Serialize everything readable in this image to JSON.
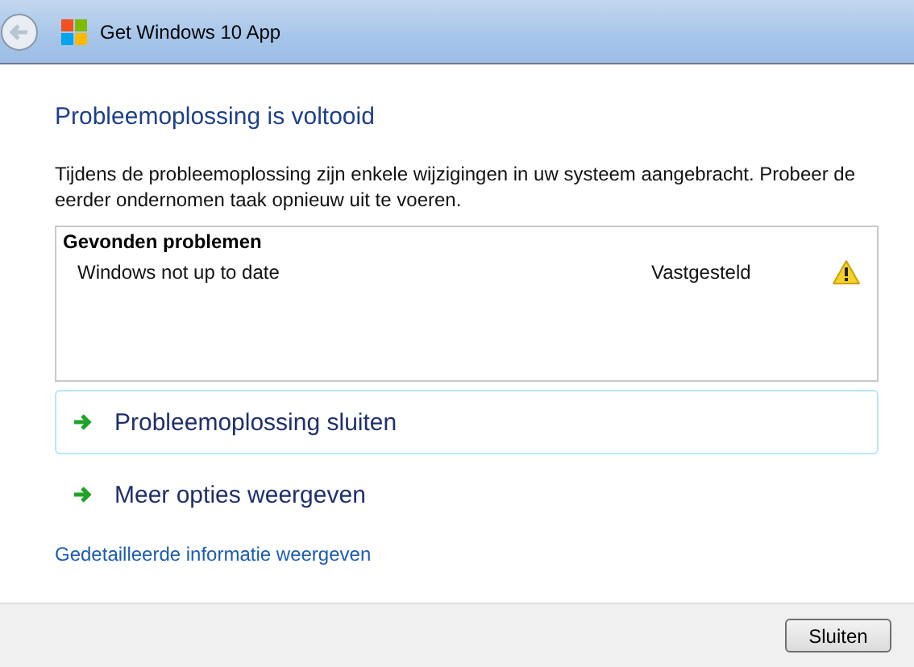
{
  "window": {
    "title": "Get Windows 10 App"
  },
  "heading": "Probleemoplossing is voltooid",
  "description": "Tijdens de probleemoplossing zijn enkele wijzigingen in uw systeem aangebracht. Probeer de eerder ondernomen taak opnieuw uit te voeren.",
  "problems": {
    "title": "Gevonden problemen",
    "rows": [
      {
        "name": "Windows not up to date",
        "status": "Vastgesteld",
        "warning": true
      }
    ]
  },
  "command_links": [
    {
      "label": "Probleemoplossing sluiten",
      "highlighted": true
    },
    {
      "label": "Meer opties weergeven",
      "highlighted": false
    }
  ],
  "details_link": "Gedetailleerde informatie weergeven",
  "buttons": [
    "Sluiten"
  ]
}
